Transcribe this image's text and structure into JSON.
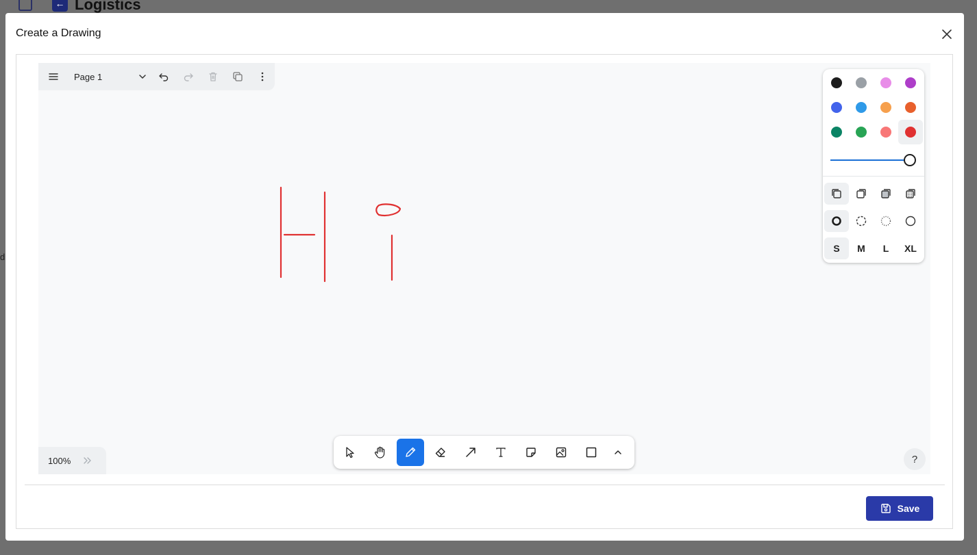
{
  "background_page": {
    "title": "Logistics",
    "side_letter": "d"
  },
  "modal": {
    "title": "Create a Drawing",
    "save_label": "Save"
  },
  "editor": {
    "page_name": "Page 1",
    "zoom": "100%",
    "help_label": "?",
    "colors": [
      {
        "name": "black",
        "hex": "#1d1d1d"
      },
      {
        "name": "grey",
        "hex": "#9aa0a6"
      },
      {
        "name": "light-violet",
        "hex": "#e88de8"
      },
      {
        "name": "violet",
        "hex": "#ae3ec9"
      },
      {
        "name": "blue",
        "hex": "#4263eb"
      },
      {
        "name": "light-blue",
        "hex": "#2f9ae8"
      },
      {
        "name": "yellow",
        "hex": "#f6a04d"
      },
      {
        "name": "orange",
        "hex": "#e8602c"
      },
      {
        "name": "green",
        "hex": "#0b8465"
      },
      {
        "name": "light-green",
        "hex": "#28a455"
      },
      {
        "name": "light-red",
        "hex": "#f87777"
      },
      {
        "name": "red",
        "hex": "#e03131"
      }
    ],
    "selected_color": "red",
    "opacity": 1.0,
    "sizes": [
      "S",
      "M",
      "L",
      "XL"
    ],
    "selected_size": "S",
    "accent": "#1a73e8",
    "stroke_color": "#e03131"
  }
}
